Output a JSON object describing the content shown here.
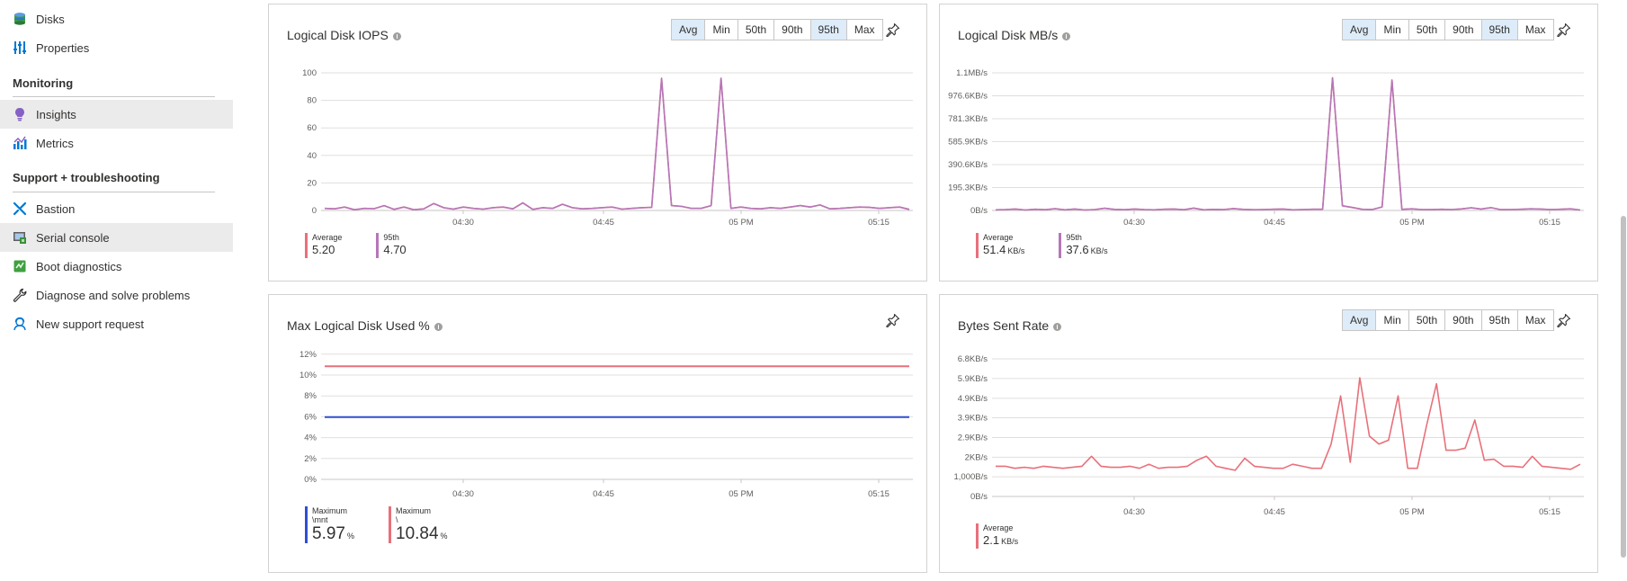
{
  "sidebar": {
    "items_top": [
      {
        "label": "Disks",
        "icon": "disks-icon"
      },
      {
        "label": "Properties",
        "icon": "properties-icon"
      }
    ],
    "monitoring_header": "Monitoring",
    "monitoring_items": [
      {
        "label": "Insights",
        "icon": "insights-icon",
        "selected": true
      },
      {
        "label": "Metrics",
        "icon": "metrics-icon",
        "selected": false
      }
    ],
    "support_header": "Support + troubleshooting",
    "support_items": [
      {
        "label": "Bastion",
        "icon": "bastion-icon",
        "selected": false
      },
      {
        "label": "Serial console",
        "icon": "serial-console-icon",
        "selected": true
      },
      {
        "label": "Boot diagnostics",
        "icon": "boot-diagnostics-icon",
        "selected": false
      },
      {
        "label": "Diagnose and solve problems",
        "icon": "wrench-icon",
        "selected": false
      },
      {
        "label": "New support request",
        "icon": "support-request-icon",
        "selected": false
      }
    ]
  },
  "colors": {
    "accent_blue": "#0078d4",
    "series_red": "#e8707a",
    "series_purple": "#b676b8",
    "series_blue": "#2f4fd1",
    "grid": "#e1dfdd",
    "segment_active": "#deecf9"
  },
  "segment_labels": [
    "Avg",
    "Min",
    "50th",
    "90th",
    "95th",
    "Max"
  ],
  "panels": {
    "iops": {
      "title": "Logical Disk IOPS",
      "active_segments": [
        "Avg",
        "95th"
      ],
      "legend": [
        {
          "name": "Average",
          "value": "5.20",
          "unit": ""
        },
        {
          "name": "95th",
          "value": "4.70",
          "unit": ""
        }
      ]
    },
    "mbs": {
      "title": "Logical Disk MB/s",
      "active_segments": [
        "Avg",
        "95th"
      ],
      "legend": [
        {
          "name": "Average",
          "value": "51.4",
          "unit": "KB/s"
        },
        {
          "name": "95th",
          "value": "37.6",
          "unit": "KB/s"
        }
      ]
    },
    "used": {
      "title": "Max Logical Disk Used %",
      "legend": [
        {
          "name": "Maximum",
          "sub": "\\mnt",
          "value": "5.97",
          "unit": "%"
        },
        {
          "name": "Maximum",
          "sub": "\\",
          "value": "10.84",
          "unit": "%"
        }
      ]
    },
    "sent": {
      "title": "Bytes Sent Rate",
      "active_segments": [
        "Avg"
      ],
      "legend": [
        {
          "name": "Average",
          "value": "2.1",
          "unit": "KB/s"
        }
      ]
    }
  },
  "chart_data": [
    {
      "id": "iops",
      "type": "line",
      "title": "Logical Disk IOPS",
      "x_ticks": [
        "04:30",
        "04:45",
        "05 PM",
        "05:15"
      ],
      "y_ticks": [
        "0",
        "20",
        "40",
        "60",
        "80",
        "100"
      ],
      "ylim": [
        0,
        100
      ],
      "grid": true,
      "series": [
        {
          "name": "Average",
          "color": "#e8707a",
          "values": [
            1.5,
            1.2,
            2.5,
            0.5,
            1.5,
            1.3,
            3.5,
            0.8,
            2.5,
            0.5,
            1.2,
            5,
            2,
            1,
            2.5,
            1.5,
            1,
            2,
            2.5,
            1.2,
            5.5,
            0.8,
            2,
            1.5,
            4.5,
            2,
            1.2,
            1.5,
            2,
            2.5,
            1,
            1.5,
            2,
            2.2,
            96,
            3.5,
            3,
            1.5,
            1.5,
            3.5,
            96,
            1.5,
            2.5,
            1.5,
            1.2,
            2,
            1.5,
            2.5,
            3.5,
            2.5,
            4,
            1.2,
            1.5,
            2,
            2.5,
            2.2,
            1.5,
            2,
            2.5,
            0.8
          ]
        },
        {
          "name": "95th",
          "color": "#b676b8",
          "values": [
            1.5,
            1.2,
            2.5,
            0.5,
            1.5,
            1.3,
            3.5,
            0.8,
            2.5,
            0.5,
            1.2,
            5,
            2,
            1,
            2.5,
            1.5,
            1,
            2,
            2.5,
            1.2,
            5.5,
            0.8,
            2,
            1.5,
            4.5,
            2,
            1.2,
            1.5,
            2,
            2.5,
            1,
            1.5,
            2,
            2.2,
            96,
            3.5,
            3,
            1.5,
            1.5,
            3.5,
            96,
            1.5,
            2.5,
            1.5,
            1.2,
            2,
            1.5,
            2.5,
            3.5,
            2.5,
            4,
            1.2,
            1.5,
            2,
            2.5,
            2.2,
            1.5,
            2,
            2.5,
            0.8
          ]
        }
      ]
    },
    {
      "id": "mbs",
      "type": "line",
      "title": "Logical Disk MB/s",
      "x_ticks": [
        "04:30",
        "04:45",
        "05 PM",
        "05:15"
      ],
      "y_ticks": [
        "0B/s",
        "195.3KB/s",
        "390.6KB/s",
        "585.9KB/s",
        "781.3KB/s",
        "976.6KB/s",
        "1.1MB/s"
      ],
      "ylim_kbs": [
        0,
        1171.9
      ],
      "grid": true,
      "series": [
        {
          "name": "Average",
          "color": "#e8707a",
          "values_kbs": [
            5,
            8,
            12,
            4,
            10,
            6,
            15,
            5,
            12,
            4,
            8,
            18,
            9,
            6,
            12,
            8,
            5,
            10,
            12,
            6,
            20,
            5,
            9,
            8,
            16,
            9,
            6,
            8,
            10,
            12,
            5,
            8,
            10,
            11,
            1130,
            40,
            25,
            10,
            8,
            30,
            1110,
            9,
            14,
            8,
            7,
            10,
            8,
            13,
            22,
            12,
            24,
            7,
            8,
            10,
            14,
            12,
            8,
            10,
            14,
            4
          ]
        },
        {
          "name": "95th",
          "color": "#b676b8",
          "values_kbs": [
            5,
            8,
            12,
            4,
            10,
            6,
            15,
            5,
            12,
            4,
            8,
            18,
            9,
            6,
            12,
            8,
            5,
            10,
            12,
            6,
            20,
            5,
            9,
            8,
            16,
            9,
            6,
            8,
            10,
            12,
            5,
            8,
            10,
            11,
            1130,
            40,
            25,
            10,
            8,
            30,
            1110,
            9,
            14,
            8,
            7,
            10,
            8,
            13,
            22,
            12,
            24,
            7,
            8,
            10,
            14,
            12,
            8,
            10,
            14,
            4
          ]
        }
      ]
    },
    {
      "id": "used",
      "type": "line",
      "title": "Max Logical Disk Used %",
      "x_ticks": [
        "04:30",
        "04:45",
        "05 PM",
        "05:15"
      ],
      "y_ticks": [
        "0%",
        "2%",
        "4%",
        "6%",
        "8%",
        "10%",
        "12%"
      ],
      "ylim": [
        0,
        12.5
      ],
      "grid": true,
      "series": [
        {
          "name": "Maximum \\mnt",
          "color": "#2f4fd1",
          "values": [
            5.97,
            5.97,
            5.97,
            5.97,
            5.97,
            5.97,
            5.97,
            5.97,
            5.97,
            5.97,
            5.97,
            5.97,
            5.97,
            5.97,
            5.97,
            5.97,
            5.97,
            5.97,
            5.97,
            5.97,
            5.97,
            5.97,
            5.97,
            5.97,
            5.97,
            5.97,
            5.97,
            5.97,
            5.97,
            5.97,
            5.97,
            5.97,
            5.97,
            5.97,
            5.97,
            5.97,
            5.97,
            5.97,
            5.97,
            5.97,
            5.97,
            5.97,
            5.97,
            5.97,
            5.97,
            5.97,
            5.97,
            5.97,
            5.97,
            5.97,
            5.97,
            5.97,
            5.97,
            5.97,
            5.97,
            5.97,
            5.97,
            5.97,
            5.97,
            5.97
          ]
        },
        {
          "name": "Maximum \\",
          "color": "#e8707a",
          "values": [
            10.84,
            10.84,
            10.84,
            10.84,
            10.84,
            10.84,
            10.84,
            10.84,
            10.84,
            10.84,
            10.84,
            10.84,
            10.84,
            10.84,
            10.84,
            10.84,
            10.84,
            10.84,
            10.84,
            10.84,
            10.84,
            10.84,
            10.84,
            10.84,
            10.84,
            10.84,
            10.84,
            10.84,
            10.84,
            10.84,
            10.84,
            10.84,
            10.84,
            10.84,
            10.84,
            10.84,
            10.84,
            10.84,
            10.84,
            10.84,
            10.84,
            10.84,
            10.84,
            10.84,
            10.84,
            10.84,
            10.84,
            10.84,
            10.84,
            10.84,
            10.84,
            10.84,
            10.84,
            10.84,
            10.84,
            10.84,
            10.84,
            10.84,
            10.84,
            10.84
          ]
        }
      ]
    },
    {
      "id": "sent",
      "type": "line",
      "title": "Bytes Sent Rate",
      "x_ticks": [
        "04:30",
        "04:45",
        "05 PM",
        "05:15"
      ],
      "y_ticks": [
        "0B/s",
        "1,000B/s",
        "2KB/s",
        "2.9KB/s",
        "3.9KB/s",
        "4.9KB/s",
        "5.9KB/s",
        "6.8KB/s"
      ],
      "ylim_kbs": [
        0,
        6.84
      ],
      "grid": true,
      "series": [
        {
          "name": "Average",
          "color": "#e8707a",
          "values_kbs": [
            1.5,
            1.5,
            1.4,
            1.45,
            1.4,
            1.5,
            1.45,
            1.4,
            1.45,
            1.5,
            2.0,
            1.5,
            1.45,
            1.45,
            1.5,
            1.4,
            1.6,
            1.4,
            1.45,
            1.45,
            1.5,
            1.8,
            2.0,
            1.5,
            1.4,
            1.3,
            1.9,
            1.5,
            1.45,
            1.4,
            1.4,
            1.6,
            1.5,
            1.4,
            1.4,
            2.6,
            5.0,
            1.7,
            5.9,
            3.0,
            2.6,
            2.8,
            5.0,
            1.4,
            1.4,
            3.6,
            5.6,
            2.3,
            2.3,
            2.4,
            3.8,
            1.8,
            1.85,
            1.5,
            1.5,
            1.45,
            2.0,
            1.5,
            1.45,
            1.4,
            1.35,
            1.6
          ]
        }
      ]
    }
  ]
}
